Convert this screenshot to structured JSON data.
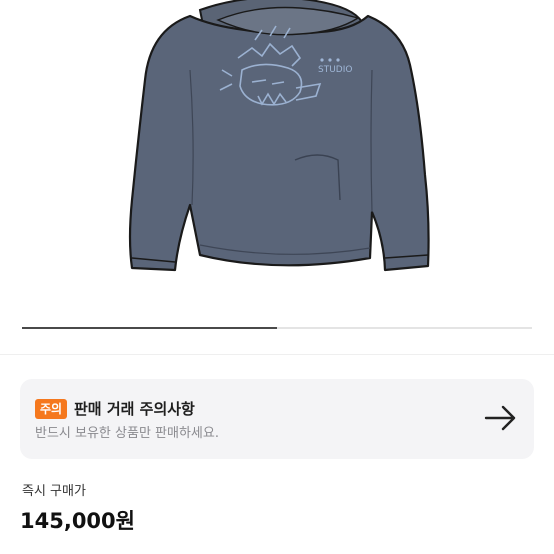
{
  "gallery": {
    "image_description_name": "hoodie-product-photo",
    "progress_fraction": 0.5
  },
  "notice": {
    "badge": "주의",
    "title": "판매 거래 주의사항",
    "description": "반드시 보유한 상품만 판매하세요.",
    "arrow_icon": "arrow-right-icon",
    "badge_color": "#f5781e"
  },
  "price": {
    "label": "즉시 구매가",
    "value": "145,000원"
  },
  "product_print": {
    "text": "STUDIO"
  }
}
